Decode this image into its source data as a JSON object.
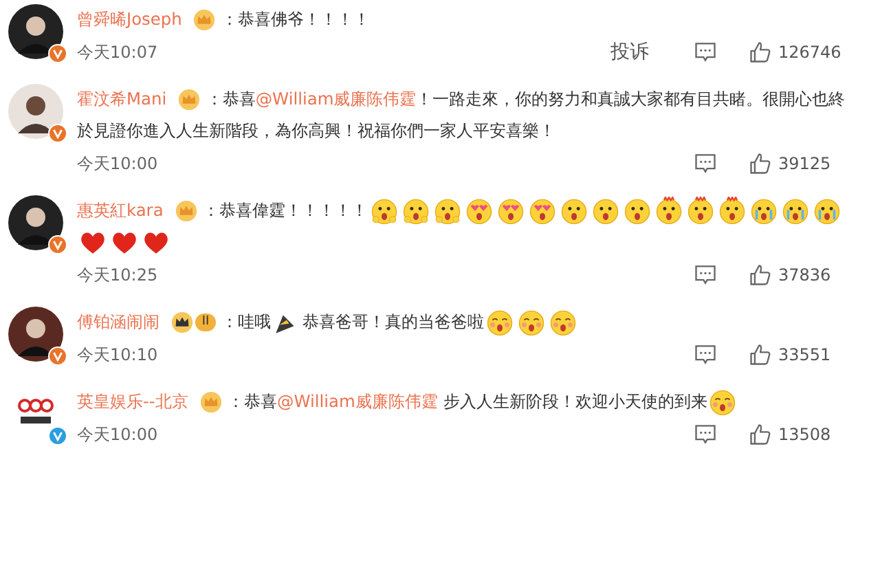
{
  "comments": [
    {
      "name": "曾舜晞Joseph",
      "avatar": {
        "kind": "dark"
      },
      "badge": {
        "kind": "crown"
      },
      "verified": {
        "color": "#e8742a"
      },
      "content": [
        {
          "kind": "text",
          "text": "：恭喜佛爷！！！！"
        }
      ],
      "time": "今天10:07",
      "report": "投诉",
      "likes": "126746"
    },
    {
      "name": "霍汶希Mani",
      "avatar": {
        "kind": "light"
      },
      "badge": {
        "kind": "crown"
      },
      "verified": {
        "color": "#e8742a"
      },
      "content": [
        {
          "kind": "text",
          "text": "：恭喜"
        },
        {
          "kind": "mention",
          "text": "@William威廉陈伟霆"
        },
        {
          "kind": "text",
          "text": "！一路走來，你的努力和真誠大家都有目共睹。很開心也終"
        },
        {
          "kind": "line",
          "text": "於見證你進入人生新階段，為你高興！祝福你們一家人平安喜樂！"
        }
      ],
      "time": "今天10:00",
      "likes": "39125"
    },
    {
      "name": "惠英紅kara",
      "avatar": {
        "kind": "dark"
      },
      "badge": {
        "kind": "crown"
      },
      "verified": {
        "color": "#e8742a"
      },
      "content": [
        {
          "kind": "text",
          "text": "：恭喜偉霆！！！！！"
        },
        {
          "kind": "shock"
        },
        {
          "kind": "shock"
        },
        {
          "kind": "shock"
        },
        {
          "kind": "hearteyes"
        },
        {
          "kind": "hearteyes"
        },
        {
          "kind": "hearteyes"
        },
        {
          "kind": "wow"
        },
        {
          "kind": "wow"
        },
        {
          "kind": "wow"
        },
        {
          "kind": "spiky"
        },
        {
          "kind": "spiky"
        },
        {
          "kind": "spiky"
        },
        {
          "kind": "tears"
        },
        {
          "kind": "tears"
        },
        {
          "kind": "tears"
        },
        {
          "kind": "heart"
        },
        {
          "kind": "heart"
        },
        {
          "kind": "heart"
        }
      ],
      "time": "今天10:25",
      "likes": "37836"
    },
    {
      "name": "傅铂涵闹闹",
      "avatar": {
        "kind": "red"
      },
      "badge": {
        "kind": "crown-level",
        "text": "II"
      },
      "verified": {
        "color": "#e8742a"
      },
      "content": [
        {
          "kind": "text",
          "text": "：哇哦"
        },
        {
          "kind": "horn"
        },
        {
          "kind": "text",
          "text": "恭喜爸哥！真的当爸爸啦"
        },
        {
          "kind": "blush"
        },
        {
          "kind": "blush"
        },
        {
          "kind": "blush"
        }
      ],
      "time": "今天10:10",
      "likes": "33551"
    },
    {
      "name": "英皇娱乐--北京",
      "avatar": {
        "kind": "logo"
      },
      "badge": {
        "kind": "crown"
      },
      "verified": {
        "color": "#2a9ee0"
      },
      "content": [
        {
          "kind": "text",
          "text": "：恭喜"
        },
        {
          "kind": "mention",
          "text": "@William威廉陈伟霆"
        },
        {
          "kind": "text",
          "text": " 步入人生新阶段！欢迎小天使的到来"
        },
        {
          "kind": "blush"
        }
      ],
      "time": "今天10:00",
      "likes": "13508"
    }
  ]
}
